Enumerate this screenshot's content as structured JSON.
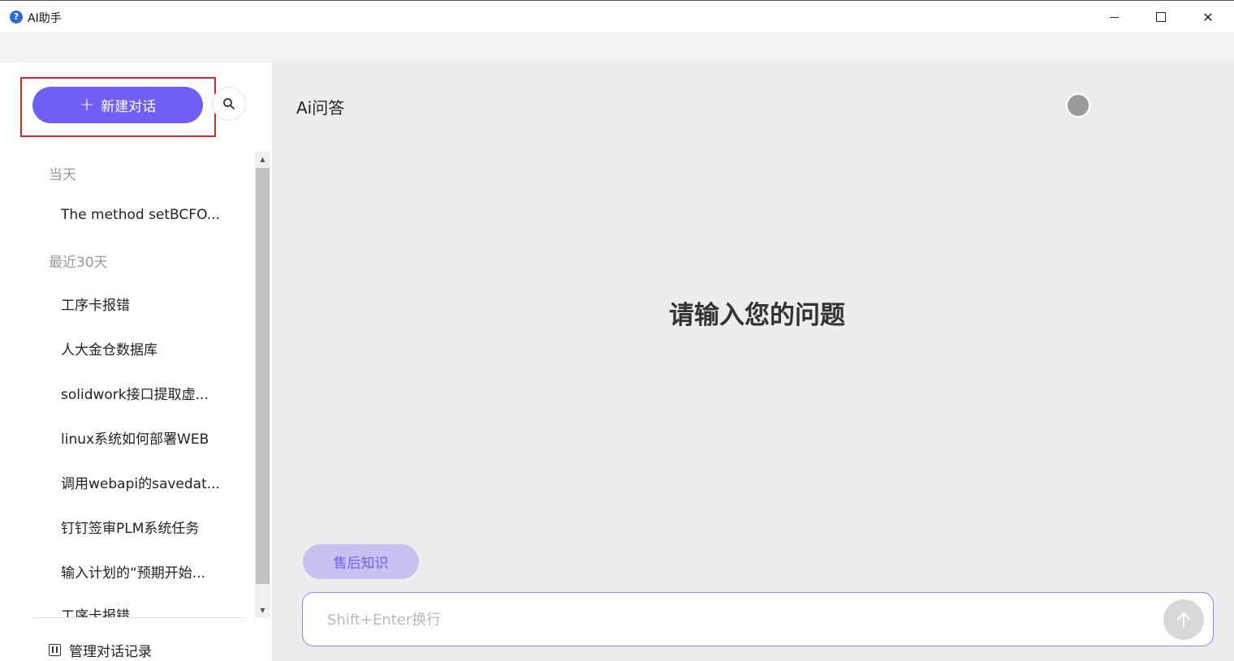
{
  "window": {
    "title": "AI助手",
    "icon": "help-circle-icon",
    "controls": [
      "minimize-icon",
      "maximize-icon",
      "close-icon"
    ]
  },
  "sidebar": {
    "new_chat_label": "新建对话",
    "new_chat_icon": "plus-icon",
    "search_icon": "search-icon",
    "groups": [
      {
        "label": "当天",
        "items": [
          "The method setBCFO..."
        ]
      },
      {
        "label": "最近30天",
        "items": [
          "工序卡报错",
          "人大金仓数据库",
          "solidwork接口提取虚...",
          "linux系统如何部署WEB",
          "调用webapi的savedat...",
          "钉钉签审PLM系统任务",
          "输入计划的“预期开始...",
          "工序卡报错"
        ]
      }
    ],
    "manage_label": "管理对话记录",
    "manage_icon": "settings-sliders-icon"
  },
  "main": {
    "title": "Ai问答",
    "prompt": "请输入您的问题",
    "chip_label": "售后知识",
    "input_placeholder": "Shift+Enter换行",
    "send_icon": "arrow-up-icon",
    "accent_color": "#6f5ff2",
    "highlight_color": "#e0241f"
  }
}
